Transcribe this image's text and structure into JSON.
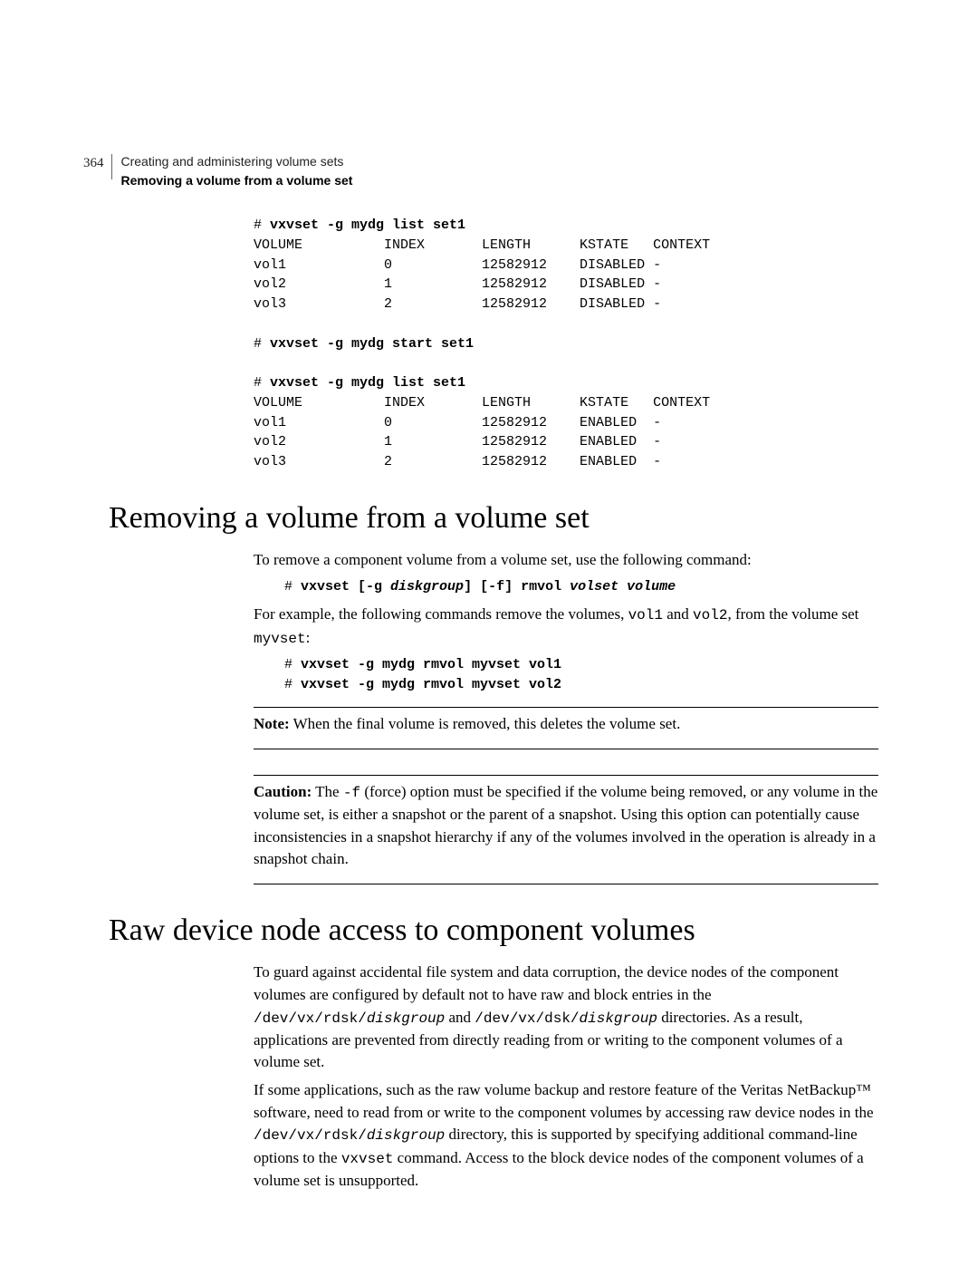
{
  "header": {
    "page_number": "364",
    "chapter": "Creating and administering volume sets",
    "section": "Removing a volume from a volume set"
  },
  "top_block": {
    "cmd1_prompt": "# ",
    "cmd1": "vxvset -g mydg list set1",
    "hdr": "VOLUME          INDEX       LENGTH      KSTATE   CONTEXT",
    "row1": "vol1            0           12582912    DISABLED -",
    "row2": "vol2            1           12582912    DISABLED -",
    "row3": "vol3            2           12582912    DISABLED -",
    "cmd2_prompt": "# ",
    "cmd2": "vxvset -g mydg start set1",
    "cmd3_prompt": "# ",
    "cmd3": "vxvset -g mydg list set1",
    "hdr2": "VOLUME          INDEX       LENGTH      KSTATE   CONTEXT",
    "row21": "vol1            0           12582912    ENABLED  -",
    "row22": "vol2            1           12582912    ENABLED  -",
    "row23": "vol3            2           12582912    ENABLED  -"
  },
  "section1": {
    "heading": "Removing a volume from a volume set",
    "para1": "To remove a component volume from a volume set, use the following command:",
    "syntax_prompt": "# ",
    "syntax_pre": "vxvset [-g ",
    "syntax_dg": "diskgroup",
    "syntax_mid": "] [-f] rmvol ",
    "syntax_volset": "volset volume",
    "para2a": "For example, the following commands remove the volumes, ",
    "para2_vol1": "vol1",
    "para2_and": " and ",
    "para2_vol2": "vol2",
    "para2b": ", from the volume set ",
    "para2_set": "myvset",
    "para2c": ":",
    "ex1p": "# ",
    "ex1": "vxvset -g mydg rmvol myvset vol1",
    "ex2p": "# ",
    "ex2": "vxvset -g mydg rmvol myvset vol2",
    "note_label": "Note:",
    "note_text": " When the final volume is removed, this deletes the volume set.",
    "caution_label": "Caution:",
    "caution_text1": " The ",
    "caution_flag": "-f",
    "caution_text2": " (force) option must be specified if the volume being removed, or any volume in the volume set, is either a snapshot or the parent of a snapshot. Using this option can potentially cause inconsistencies in a snapshot hierarchy if any of the volumes involved in the operation is already in a snapshot chain."
  },
  "section2": {
    "heading": "Raw device node access to component volumes",
    "para1a": "To guard against accidental file system and data corruption, the device nodes of the component volumes are configured by default not to have raw and block entries in the ",
    "path1": "/dev/vx/rdsk/",
    "dg1": "diskgroup",
    "para1b": " and ",
    "path2": "/dev/vx/dsk/",
    "dg2": "diskgroup",
    "para1c": " directories. As a result, applications are prevented from directly reading from or writing to the component volumes of a volume set.",
    "para2a": "If some applications, such as the raw volume backup and restore feature of the Veritas NetBackup™ software, need to read from or write to the component volumes by accessing raw device nodes in the ",
    "path3": "/dev/vx/rdsk/",
    "dg3": "diskgroup",
    "para2b": " directory, this is supported by specifying additional command-line options to the ",
    "cmd": "vxvset",
    "para2c": " command. Access to the block device nodes of the component volumes of a volume set is unsupported."
  }
}
